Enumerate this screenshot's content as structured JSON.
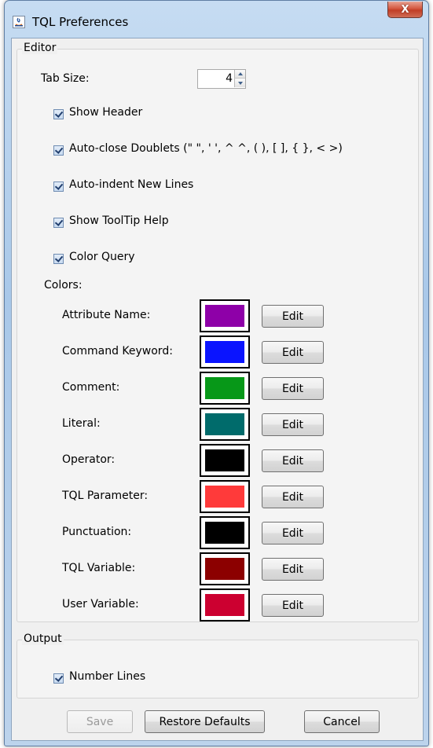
{
  "window": {
    "title": "TQL Preferences",
    "close_label": "X"
  },
  "editor": {
    "group_title": "Editor",
    "tab_size_label": "Tab Size:",
    "tab_size_value": "4",
    "checkboxes": [
      {
        "label": "Show Header",
        "checked": true
      },
      {
        "label": "Auto-close Doublets (\" \", ' ', ^ ^, ( ), [ ], { }, < >)",
        "checked": true
      },
      {
        "label": "Auto-indent New Lines",
        "checked": true
      },
      {
        "label": "Show ToolTip Help",
        "checked": true
      },
      {
        "label": "Color Query",
        "checked": true
      }
    ],
    "colors_label": "Colors:",
    "edit_label": "Edit",
    "colors": [
      {
        "label": "Attribute Name:",
        "color": "#8e00a8"
      },
      {
        "label": "Command Keyword:",
        "color": "#0a14ff"
      },
      {
        "label": "Comment:",
        "color": "#079818"
      },
      {
        "label": "Literal:",
        "color": "#006b6b"
      },
      {
        "label": "Operator:",
        "color": "#000000"
      },
      {
        "label": "TQL Parameter:",
        "color": "#ff3a3a"
      },
      {
        "label": "Punctuation:",
        "color": "#000000"
      },
      {
        "label": "TQL Variable:",
        "color": "#8c0000"
      },
      {
        "label": "User Variable:",
        "color": "#cc0030"
      }
    ]
  },
  "output": {
    "group_title": "Output",
    "number_lines_label": "Number Lines",
    "number_lines_checked": true
  },
  "footer": {
    "save_label": "Save",
    "restore_label": "Restore Defaults",
    "cancel_label": "Cancel"
  }
}
